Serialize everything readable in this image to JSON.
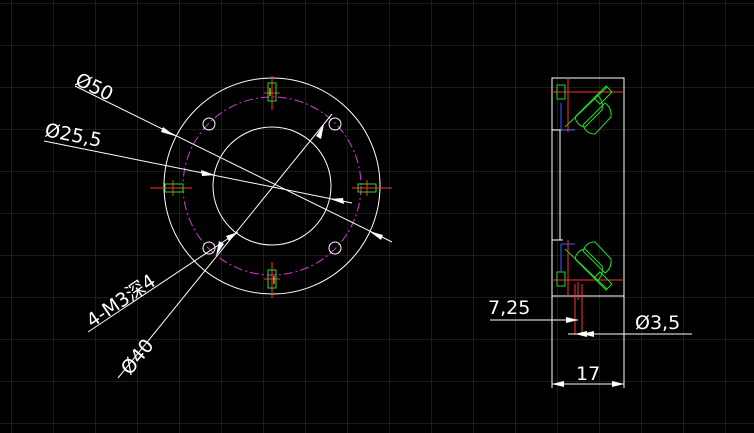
{
  "colors": {
    "background": "#000000",
    "grid": "#3a3a3a",
    "geometry": "#ffffff",
    "bolt_circle": "#d23cd2",
    "center_marks": "#ff3030",
    "threads": "#22dd22",
    "hidden_lines": "#3b5bff",
    "accent": "#ffff30"
  },
  "dimensions": {
    "outer_diameter": "Ø50",
    "inner_diameter": "Ø25,5",
    "bolt_circle_diameter": "Ø40",
    "threaded_holes": "4-M3深4",
    "pin_offset": "7,25",
    "pin_diameter": "Ø3,5",
    "thickness": "17"
  }
}
